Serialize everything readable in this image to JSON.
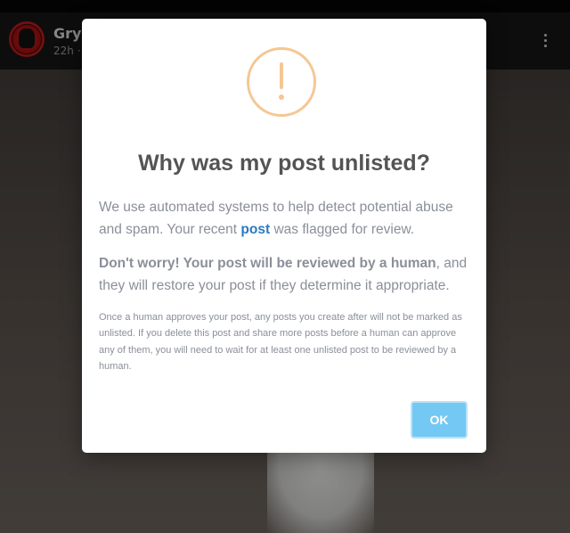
{
  "post_header": {
    "author_name": "Gry",
    "time": "22h ·"
  },
  "modal": {
    "title": "Why was my post unlisted?",
    "p1_before": "We use automated systems to help detect potential abuse and spam. Your recent ",
    "p1_link": "post",
    "p1_after": " was flagged for review.",
    "p2_bold": "Don't worry! Your post will be reviewed by a human",
    "p2_rest": ", and they will restore your post if they determine it appropriate.",
    "fine_print": "Once a human approves your post, any posts you create after will not be marked as unlisted. If you delete this post and share more posts before a human can approve any of them, you will need to wait for at least one unlisted post to be reviewed by a human.",
    "ok_label": "OK"
  },
  "icons": {
    "warning": "exclamation-circle-icon",
    "menu": "kebab-menu-icon"
  },
  "colors": {
    "accent": "#74c8f4",
    "link": "#2a7ac0",
    "warning": "#f5c793",
    "title": "#545454",
    "body_text": "#8a8f99"
  }
}
